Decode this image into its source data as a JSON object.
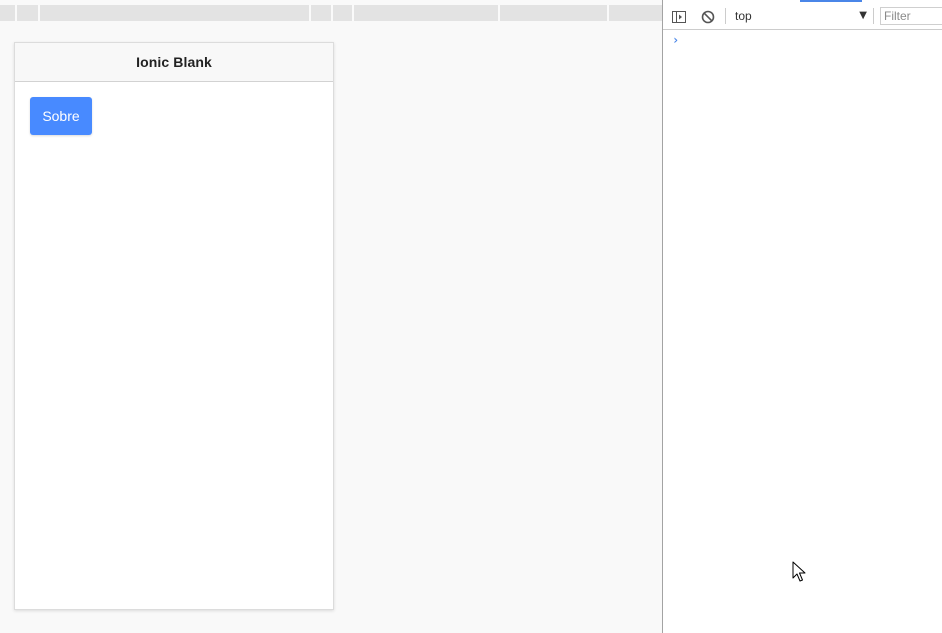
{
  "app": {
    "title": "Ionic Blank",
    "button_label": "Sobre"
  },
  "devtools": {
    "context": "top",
    "filter_placeholder": "Filter",
    "prompt_symbol": "›",
    "toggle_sidebar_icon": "sidebar-toggle-icon",
    "clear_icon": "clear-console-icon",
    "dropdown_icon": "triangle-down-icon"
  },
  "colors": {
    "button": "#488aff",
    "accent": "#4a86e8"
  }
}
